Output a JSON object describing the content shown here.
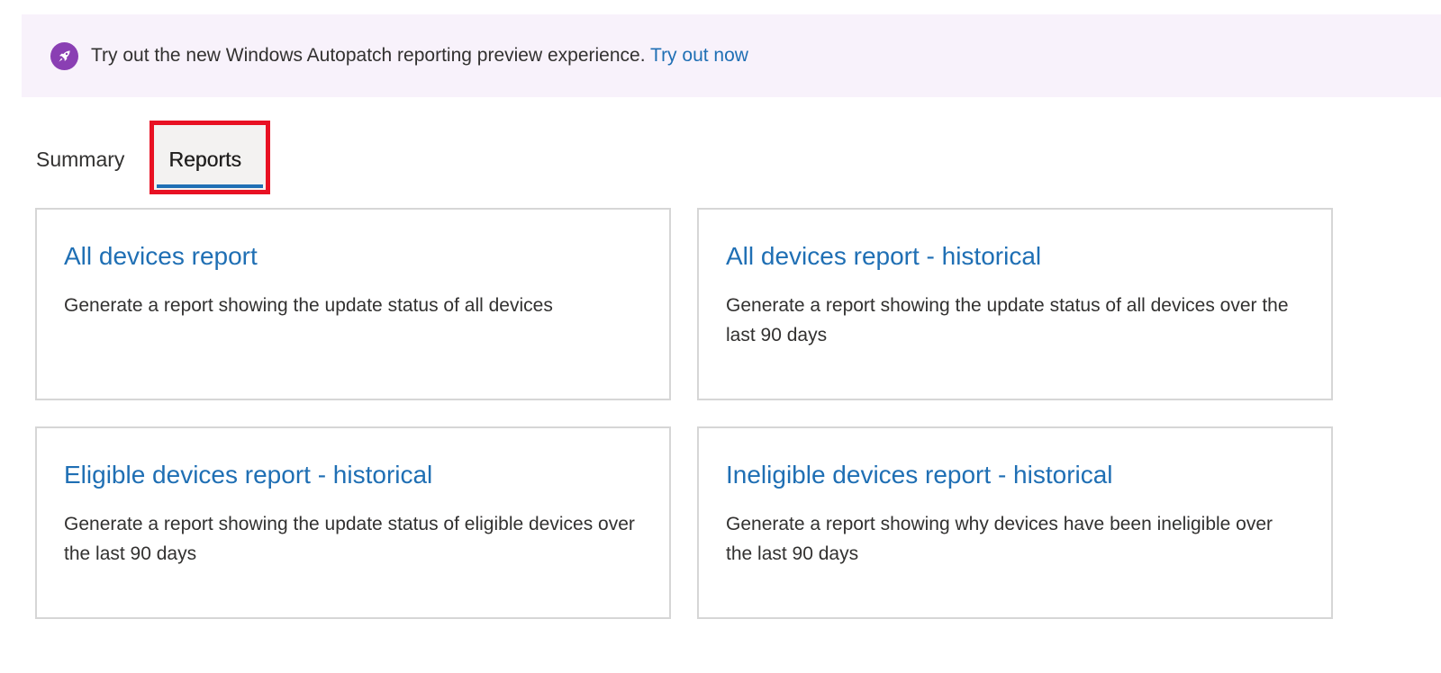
{
  "banner": {
    "icon": "rocket-icon",
    "accent_color": "#8a3fb3",
    "text": "Try out the new Windows Autopatch reporting preview experience.",
    "link_text": "Try out now"
  },
  "tabs": [
    {
      "label": "Summary",
      "selected": false
    },
    {
      "label": "Reports",
      "selected": true
    }
  ],
  "cards": [
    {
      "title": "All devices report",
      "description": "Generate a report showing the update status of all devices"
    },
    {
      "title": "All devices report - historical",
      "description": "Generate a report showing the update status of all devices over the last 90 days"
    },
    {
      "title": "Eligible devices report - historical",
      "description": "Generate a report showing the update status of eligible devices over the last 90 days"
    },
    {
      "title": "Ineligible devices report - historical",
      "description": "Generate a report showing why devices have been ineligible over the last 90 days"
    }
  ],
  "colors": {
    "link": "#1f6fb4",
    "banner_bg": "#f8f2fb",
    "highlight_border": "#e81123"
  }
}
